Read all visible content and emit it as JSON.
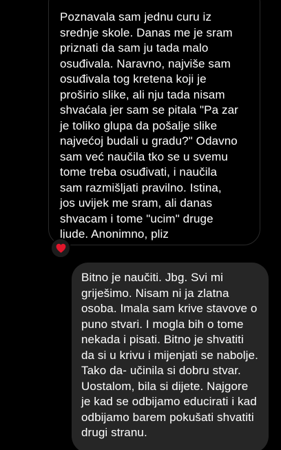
{
  "conversation": {
    "received_message": {
      "lines": [
        "Poznavala sam jednu curu iz",
        "srednje skole. Danas me je sram",
        "priznati da sam ju tada malo",
        "osuđivala. Naravno, najviše sam",
        "osuđivala tog kretena koji je",
        "proširio slike, ali nju tada nisam",
        "shvaćala jer sam se pitala \"Pa zar",
        "je toliko glupa da pošalje slike",
        "najvećoj budali u gradu?\" Odavno",
        "sam već naučila tko se u svemu",
        "tome treba osuđivati, i naučila",
        "sam razmišljati pravilno. Istina,",
        "jos uvijek me sram, ali danas",
        "shvacam i tome \"ucim\" druge",
        "ljude. Anonimno, pliz"
      ],
      "reaction": "heart-icon",
      "reaction_color": "#e0162b"
    },
    "sent_message": {
      "lines": [
        "Bitno je naučiti. Jbg. Svi mi",
        "griješimo. Nisam ni ja zlatna",
        "osoba. Imala sam krive stavove o",
        "puno stvari. I mogla bih o tome",
        "nekada i pisati. Bitno je shvatiti",
        "da si u krivu i mijenjati se nabolje.",
        "Tako da- učinila si dobru stvar.",
        "Uostalom, bila si dijete. Najgore",
        "je kad se odbijamo educirati i kad",
        "odbijamo barem pokušati shvatiti",
        "drugi stranu."
      ]
    }
  },
  "colors": {
    "background": "#000000",
    "received_bubble": "#000000",
    "received_border": "#2a2a2a",
    "sent_bubble": "#262626",
    "text": "#ffffff"
  }
}
